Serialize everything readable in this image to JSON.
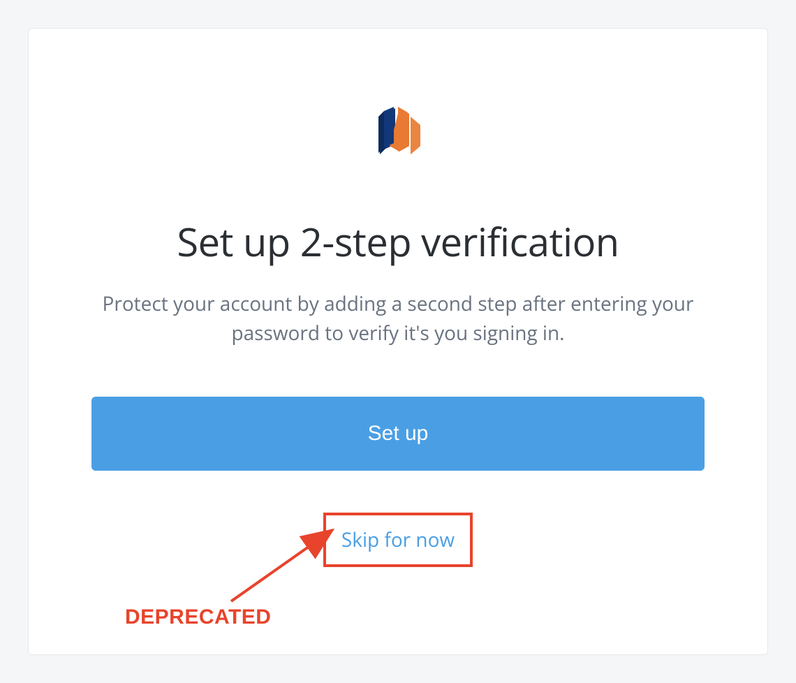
{
  "title": "Set up 2-step verification",
  "subtitle": "Protect your account by adding a second step after entering your password to verify it's you signing in.",
  "buttons": {
    "setup": "Set up",
    "skip": "Skip for now"
  },
  "annotation": {
    "label": "DEPRECATED"
  },
  "colors": {
    "primary": "#4a9fe4",
    "annotation": "#e8442c",
    "logo_navy": "#12387a",
    "logo_orange": "#e87a33"
  }
}
